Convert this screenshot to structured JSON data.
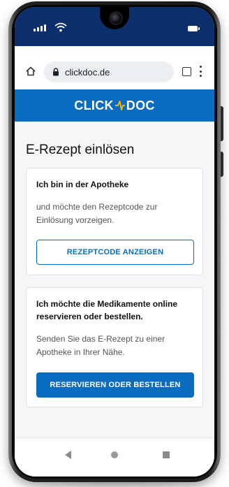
{
  "browser": {
    "url": "clickdoc.de"
  },
  "brand": {
    "name_left": "CLICK",
    "name_right": "DOC",
    "color": "#0a6cc1"
  },
  "page": {
    "title": "E-Rezept einlösen"
  },
  "card_pharmacy": {
    "title": "Ich bin in der Apotheke",
    "text": "und möchte den Rezeptcode zur Einlösung vorzeigen.",
    "button_label": "REZEPTCODE ANZEIGEN"
  },
  "card_online": {
    "title": "Ich möchte die Medikamente online reservieren oder bestellen.",
    "text": "Senden Sie das E-Rezept zu einer Apotheke in Ihrer Nähe.",
    "button_label": "RESERVIEREN ODER BESTELLEN"
  },
  "icons": {
    "status": [
      "signal-icon",
      "wifi-icon",
      "battery-icon"
    ],
    "browser": [
      "home-icon",
      "lock-icon",
      "tabs-icon",
      "menu-icon"
    ],
    "nav": [
      "back-icon",
      "home-circle-icon",
      "recents-icon"
    ]
  },
  "colors": {
    "status_bar": "#0b2f6b",
    "header": "#0a6cc1",
    "primary_button": "#0a6cc1"
  }
}
